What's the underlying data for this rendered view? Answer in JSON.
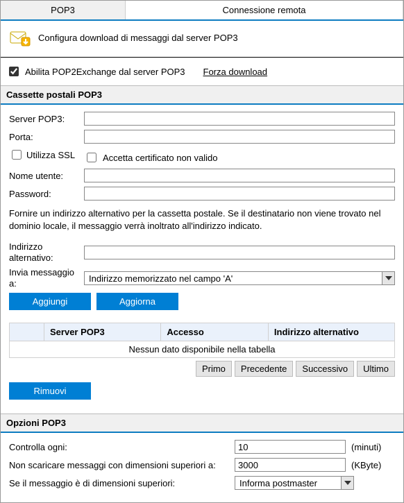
{
  "tabs": {
    "pop3": "POP3",
    "remote": "Connessione remota"
  },
  "header": {
    "title": "Configura download di messaggi dal server POP3"
  },
  "enable": {
    "label": "Abilita POP2Exchange dal server POP3",
    "force_link": "Forza download"
  },
  "mailboxes": {
    "title": "Cassette postali POP3",
    "server_label": "Server POP3:",
    "server_value": "",
    "port_label": "Porta:",
    "port_value": "",
    "ssl_label": "Utilizza SSL",
    "accept_cert_label": "Accetta certificato non valido",
    "username_label": "Nome utente:",
    "username_value": "",
    "password_label": "Password:",
    "password_value": "",
    "info_text": "Fornire un indirizzo alternativo per la cassetta postale. Se il destinatario non viene trovato nel dominio locale, il messaggio verrà inoltrato all'indirizzo indicato.",
    "alt_addr_label": "Indirizzo alternativo:",
    "alt_addr_value": "",
    "send_to_label": "Invia messaggio a:",
    "send_to_value": "Indirizzo memorizzato nel campo 'A'",
    "add_btn": "Aggiungi",
    "update_btn": "Aggiorna",
    "table": {
      "col_server": "Server POP3",
      "col_access": "Accesso",
      "col_alt": "Indirizzo alternativo",
      "empty": "Nessun dato disponibile nella tabella"
    },
    "pager": {
      "first": "Primo",
      "prev": "Precedente",
      "next": "Successivo",
      "last": "Ultimo"
    },
    "remove_btn": "Rimuovi"
  },
  "options": {
    "title": "Opzioni POP3",
    "check_every_label": "Controlla ogni:",
    "check_every_value": "10",
    "check_every_unit": "(minuti)",
    "max_size_label": "Non scaricare messaggi con dimensioni superiori a:",
    "max_size_value": "3000",
    "max_size_unit": "(KByte)",
    "if_larger_label": "Se il messaggio è di dimensioni superiori:",
    "if_larger_value": "Informa postmaster"
  }
}
